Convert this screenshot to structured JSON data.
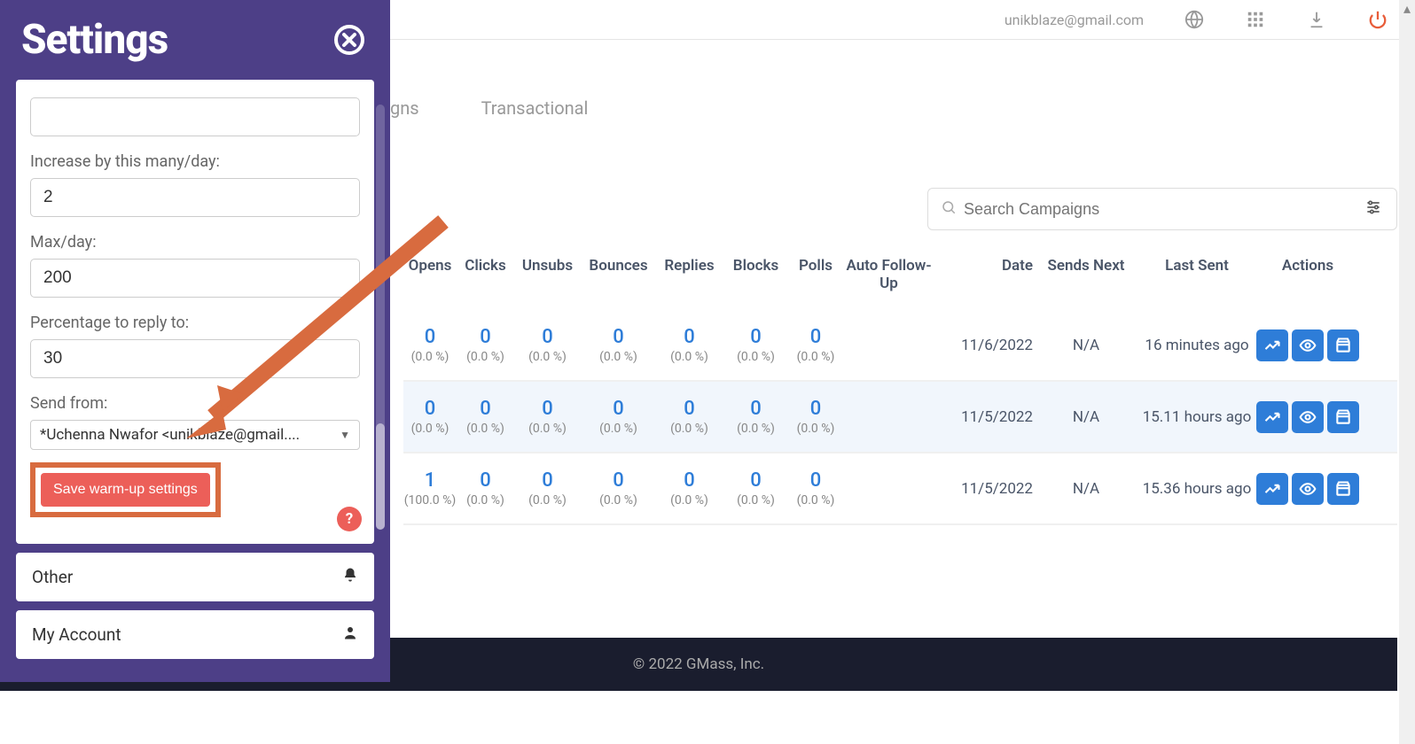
{
  "topbar": {
    "email_partial": "unikblaze@gmail.com"
  },
  "settings": {
    "title": "Settings",
    "field_top_value": "",
    "increase_label": "Increase by this many/day:",
    "increase_value": "2",
    "max_label": "Max/day:",
    "max_value": "200",
    "pct_label": "Percentage to reply to:",
    "pct_value": "30",
    "from_label": "Send from:",
    "from_value": "*Uchenna Nwafor <unikblaze@gmail....",
    "save_btn": "Save warm-up settings",
    "accordion1": "Other",
    "accordion2": "My Account"
  },
  "tabs": {
    "campaigns_partial": "gns",
    "transactional": "Transactional"
  },
  "search": {
    "placeholder": "Search Campaigns"
  },
  "table": {
    "headers": {
      "opens": "Opens",
      "clicks": "Clicks",
      "unsubs": "Unsubs",
      "bounces": "Bounces",
      "replies": "Replies",
      "blocks": "Blocks",
      "polls": "Polls",
      "followup": "Auto Follow-Up",
      "date": "Date",
      "sends_next": "Sends Next",
      "last_sent": "Last Sent",
      "actions": "Actions"
    },
    "rows": [
      {
        "opens": {
          "n": "0",
          "p": "(0.0 %)"
        },
        "clicks": {
          "n": "0",
          "p": "(0.0 %)"
        },
        "unsubs": {
          "n": "0",
          "p": "(0.0 %)"
        },
        "bounces": {
          "n": "0",
          "p": "(0.0 %)"
        },
        "replies": {
          "n": "0",
          "p": "(0.0 %)"
        },
        "blocks": {
          "n": "0",
          "p": "(0.0 %)"
        },
        "polls": {
          "n": "0",
          "p": "(0.0 %)"
        },
        "followup": "",
        "date": "11/6/2022",
        "sends_next": "N/A",
        "last_sent": "16 minutes ago"
      },
      {
        "opens": {
          "n": "0",
          "p": "(0.0 %)"
        },
        "clicks": {
          "n": "0",
          "p": "(0.0 %)"
        },
        "unsubs": {
          "n": "0",
          "p": "(0.0 %)"
        },
        "bounces": {
          "n": "0",
          "p": "(0.0 %)"
        },
        "replies": {
          "n": "0",
          "p": "(0.0 %)"
        },
        "blocks": {
          "n": "0",
          "p": "(0.0 %)"
        },
        "polls": {
          "n": "0",
          "p": "(0.0 %)"
        },
        "followup": "",
        "date": "11/5/2022",
        "sends_next": "N/A",
        "last_sent": "15.11 hours ago"
      },
      {
        "opens": {
          "n": "1",
          "p": "(100.0 %)"
        },
        "clicks": {
          "n": "0",
          "p": "(0.0 %)"
        },
        "unsubs": {
          "n": "0",
          "p": "(0.0 %)"
        },
        "bounces": {
          "n": "0",
          "p": "(0.0 %)"
        },
        "replies": {
          "n": "0",
          "p": "(0.0 %)"
        },
        "blocks": {
          "n": "0",
          "p": "(0.0 %)"
        },
        "polls": {
          "n": "0",
          "p": "(0.0 %)"
        },
        "followup": "",
        "date": "11/5/2022",
        "sends_next": "N/A",
        "last_sent": "15.36 hours ago"
      }
    ]
  },
  "footer": {
    "copyright": "© 2022 GMass, Inc."
  }
}
